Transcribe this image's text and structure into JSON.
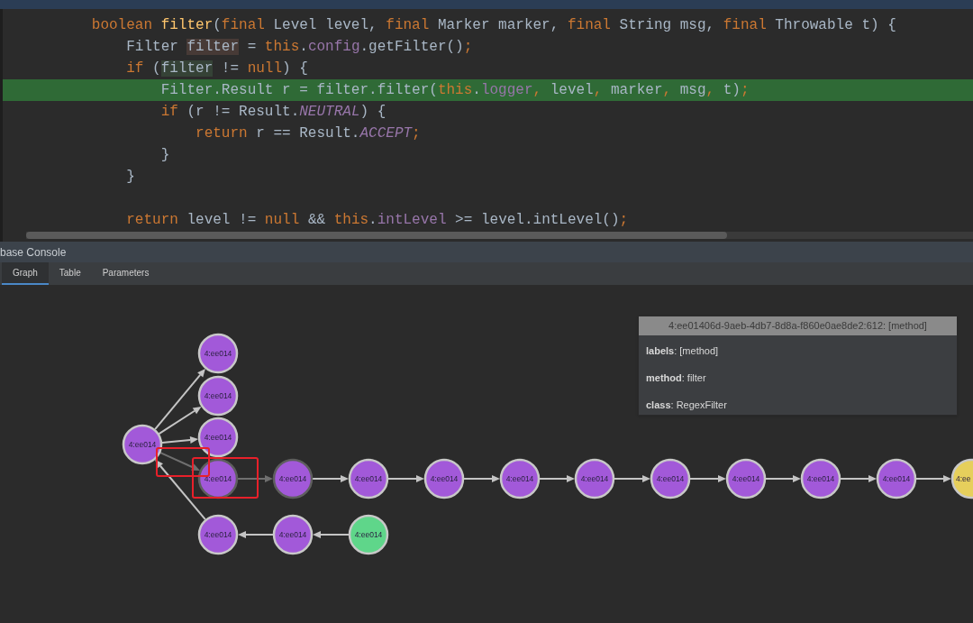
{
  "editor": {
    "lines": [
      {
        "highlighted": false,
        "tokens": [
          {
            "kind": "kw",
            "text": "        boolean "
          },
          {
            "kind": "decl",
            "text": "filter"
          },
          {
            "kind": "plain",
            "text": "("
          },
          {
            "kind": "kw",
            "text": "final "
          },
          {
            "kind": "plain",
            "text": "Level level, "
          },
          {
            "kind": "kw",
            "text": "final "
          },
          {
            "kind": "plain",
            "text": "Marker marker, "
          },
          {
            "kind": "kw",
            "text": "final "
          },
          {
            "kind": "plain",
            "text": "String msg, "
          },
          {
            "kind": "kw",
            "text": "final "
          },
          {
            "kind": "plain",
            "text": "Throwable t) {"
          }
        ]
      },
      {
        "highlighted": false,
        "tokens": [
          {
            "kind": "plain",
            "text": "            Filter "
          },
          {
            "kind": "write",
            "text": "filter"
          },
          {
            "kind": "plain",
            "text": " = "
          },
          {
            "kind": "kw",
            "text": "this"
          },
          {
            "kind": "plain",
            "text": "."
          },
          {
            "kind": "field",
            "text": "config"
          },
          {
            "kind": "plain",
            "text": ".getFilter()"
          },
          {
            "kind": "kw",
            "text": ";"
          }
        ]
      },
      {
        "highlighted": false,
        "tokens": [
          {
            "kind": "kw",
            "text": "            if "
          },
          {
            "kind": "plain",
            "text": "("
          },
          {
            "kind": "read",
            "text": "filter"
          },
          {
            "kind": "plain",
            "text": " != "
          },
          {
            "kind": "kw",
            "text": "null"
          },
          {
            "kind": "plain",
            "text": ") {"
          }
        ]
      },
      {
        "highlighted": true,
        "tokens": [
          {
            "kind": "plain",
            "text": "                Filter.Result r = filter.filter("
          },
          {
            "kind": "kw",
            "text": "this"
          },
          {
            "kind": "plain",
            "text": "."
          },
          {
            "kind": "field",
            "text": "logger"
          },
          {
            "kind": "kw",
            "text": ", "
          },
          {
            "kind": "plain",
            "text": "level"
          },
          {
            "kind": "kw",
            "text": ", "
          },
          {
            "kind": "plain",
            "text": "marker"
          },
          {
            "kind": "kw",
            "text": ", "
          },
          {
            "kind": "plain",
            "text": "msg"
          },
          {
            "kind": "kw",
            "text": ", "
          },
          {
            "kind": "plain",
            "text": "t)"
          },
          {
            "kind": "kw",
            "text": ";"
          }
        ]
      },
      {
        "highlighted": false,
        "tokens": [
          {
            "kind": "kw",
            "text": "                if "
          },
          {
            "kind": "plain",
            "text": "(r != Result."
          },
          {
            "kind": "const",
            "text": "NEUTRAL"
          },
          {
            "kind": "plain",
            "text": ") {"
          }
        ]
      },
      {
        "highlighted": false,
        "tokens": [
          {
            "kind": "kw",
            "text": "                    return "
          },
          {
            "kind": "plain",
            "text": "r == Result."
          },
          {
            "kind": "const",
            "text": "ACCEPT"
          },
          {
            "kind": "kw",
            "text": ";"
          }
        ]
      },
      {
        "highlighted": false,
        "tokens": [
          {
            "kind": "plain",
            "text": "                }"
          }
        ]
      },
      {
        "highlighted": false,
        "tokens": [
          {
            "kind": "plain",
            "text": "            }"
          }
        ]
      },
      {
        "highlighted": false
      },
      {
        "highlighted": false,
        "tokens": [
          {
            "kind": "kw",
            "text": "            return "
          },
          {
            "kind": "plain",
            "text": "level != "
          },
          {
            "kind": "kw",
            "text": "null "
          },
          {
            "kind": "plain",
            "text": "&& "
          },
          {
            "kind": "kw",
            "text": "this"
          },
          {
            "kind": "plain",
            "text": "."
          },
          {
            "kind": "field",
            "text": "intLevel"
          },
          {
            "kind": "plain",
            "text": " >= level.intLevel()"
          },
          {
            "kind": "kw",
            "text": ";"
          }
        ]
      }
    ]
  },
  "console": {
    "title": "base Console",
    "tabs": [
      {
        "label": "Graph",
        "selected": true
      },
      {
        "label": "Table",
        "selected": false
      },
      {
        "label": "Parameters",
        "selected": false
      }
    ],
    "graph": {
      "nodes": [
        {
          "label": "4:ee014",
          "color": "#a259d9",
          "selected": false
        },
        {
          "label": "4:ee014",
          "color": "#a259d9",
          "selected": false
        },
        {
          "label": "4:ee014",
          "color": "#a259d9",
          "selected": false
        },
        {
          "label": "4:ee014",
          "color": "#a259d9",
          "selected": false
        },
        {
          "label": "4:ee014",
          "color": "#a259d9",
          "selected": true
        },
        {
          "label": "4:ee014",
          "color": "#a259d9",
          "selected": false
        },
        {
          "label": "4:ee014",
          "color": "#a259d9",
          "selected": true
        },
        {
          "label": "4:ee014",
          "color": "#a259d9",
          "selected": false
        },
        {
          "label": "4:ee014",
          "color": "#a259d9",
          "selected": false
        },
        {
          "label": "4:ee014",
          "color": "#a259d9",
          "selected": false
        },
        {
          "label": "4:ee014",
          "color": "#a259d9",
          "selected": false
        },
        {
          "label": "4:ee014",
          "color": "#a259d9",
          "selected": false
        },
        {
          "label": "4:ee014",
          "color": "#a259d9",
          "selected": false
        },
        {
          "label": "4:ee014",
          "color": "#a259d9",
          "selected": false
        },
        {
          "label": "4:ee014",
          "color": "#a259d9",
          "selected": false
        },
        {
          "label": "4:ee",
          "color": "#e6cf5c",
          "selected": false
        },
        {
          "label": "4:ee014",
          "color": "#a259d9",
          "selected": false
        },
        {
          "label": "4:ee014",
          "color": "#5fd68a",
          "selected": false
        }
      ],
      "tooltip": {
        "title": "4:ee01406d-9aeb-4db7-8d8a-f860e0ae8de2:612: [method]",
        "properties": [
          "**labels**: [method]",
          "**method**: filter",
          "**class**: RegexFilter"
        ]
      }
    }
  }
}
